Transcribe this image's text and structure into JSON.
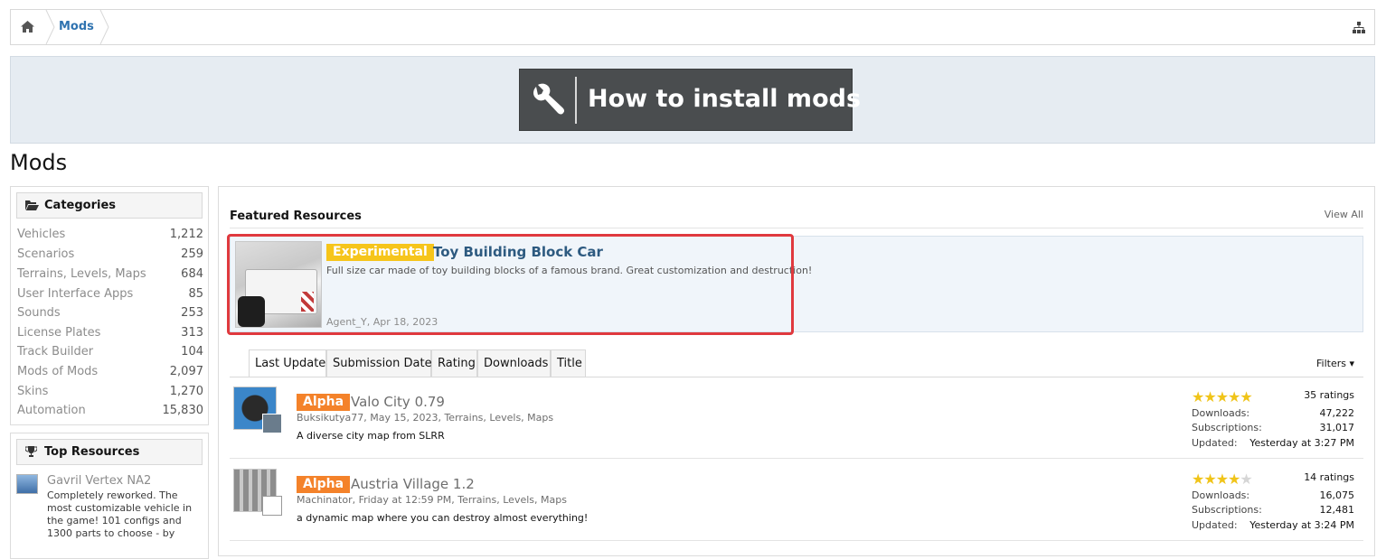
{
  "breadcrumb": {
    "current": "Mods"
  },
  "banner": {
    "label": "How to install mods"
  },
  "page_title": "Mods",
  "categories": {
    "title": "Categories",
    "items": [
      {
        "name": "Vehicles",
        "count": "1,212"
      },
      {
        "name": "Scenarios",
        "count": "259"
      },
      {
        "name": "Terrains, Levels, Maps",
        "count": "684"
      },
      {
        "name": "User Interface Apps",
        "count": "85"
      },
      {
        "name": "Sounds",
        "count": "253"
      },
      {
        "name": "License Plates",
        "count": "313"
      },
      {
        "name": "Track Builder",
        "count": "104"
      },
      {
        "name": "Mods of Mods",
        "count": "2,097"
      },
      {
        "name": "Skins",
        "count": "1,270"
      },
      {
        "name": "Automation",
        "count": "15,830"
      }
    ]
  },
  "top_resources": {
    "title": "Top Resources",
    "items": [
      {
        "title": "Gavril Vertex NA2",
        "desc": "Completely reworked. The most customizable vehicle in the game! 101 configs and 1300 parts to choose - by"
      }
    ]
  },
  "featured": {
    "title": "Featured Resources",
    "view_all": "View All",
    "item": {
      "badge": "Experimental",
      "name": "Toy Building Block Car",
      "desc": "Full size car made of toy building blocks of a famous brand. Great customization and destruction!",
      "meta": "Agent_Y, Apr 18, 2023"
    }
  },
  "tabs": [
    "Last Update",
    "Submission Date",
    "Rating",
    "Downloads",
    "Title"
  ],
  "filters_label": "Filters ▾",
  "resources": [
    {
      "badge": "Alpha",
      "name": "Valo City 0.79",
      "meta": "Buksikutya77, May 15, 2023, Terrains, Levels, Maps",
      "desc": "A diverse city map from SLRR",
      "rating": 4.5,
      "stars": "★★★★★",
      "ratings": "35 ratings",
      "downloads_label": "Downloads:",
      "downloads": "47,222",
      "subs_label": "Subscriptions:",
      "subs": "31,017",
      "updated_label": "Updated:",
      "updated": "Yesterday at 3:27 PM"
    },
    {
      "badge": "Alpha",
      "name": "Austria Village 1.2",
      "meta": "Machinator, Friday at 12:59 PM, Terrains, Levels, Maps",
      "desc": "a dynamic map where you can destroy almost everything!",
      "rating": 4,
      "stars": "★★★★",
      "stars_off": "★",
      "ratings": "14 ratings",
      "downloads_label": "Downloads:",
      "downloads": "16,075",
      "subs_label": "Subscriptions:",
      "subs": "12,481",
      "updated_label": "Updated:",
      "updated": "Yesterday at 3:24 PM"
    }
  ],
  "colors": {
    "accent": "#2f73b0",
    "alpha_badge": "#f4822a",
    "experimental_badge": "#f6c51b",
    "highlight": "#e0393e"
  }
}
